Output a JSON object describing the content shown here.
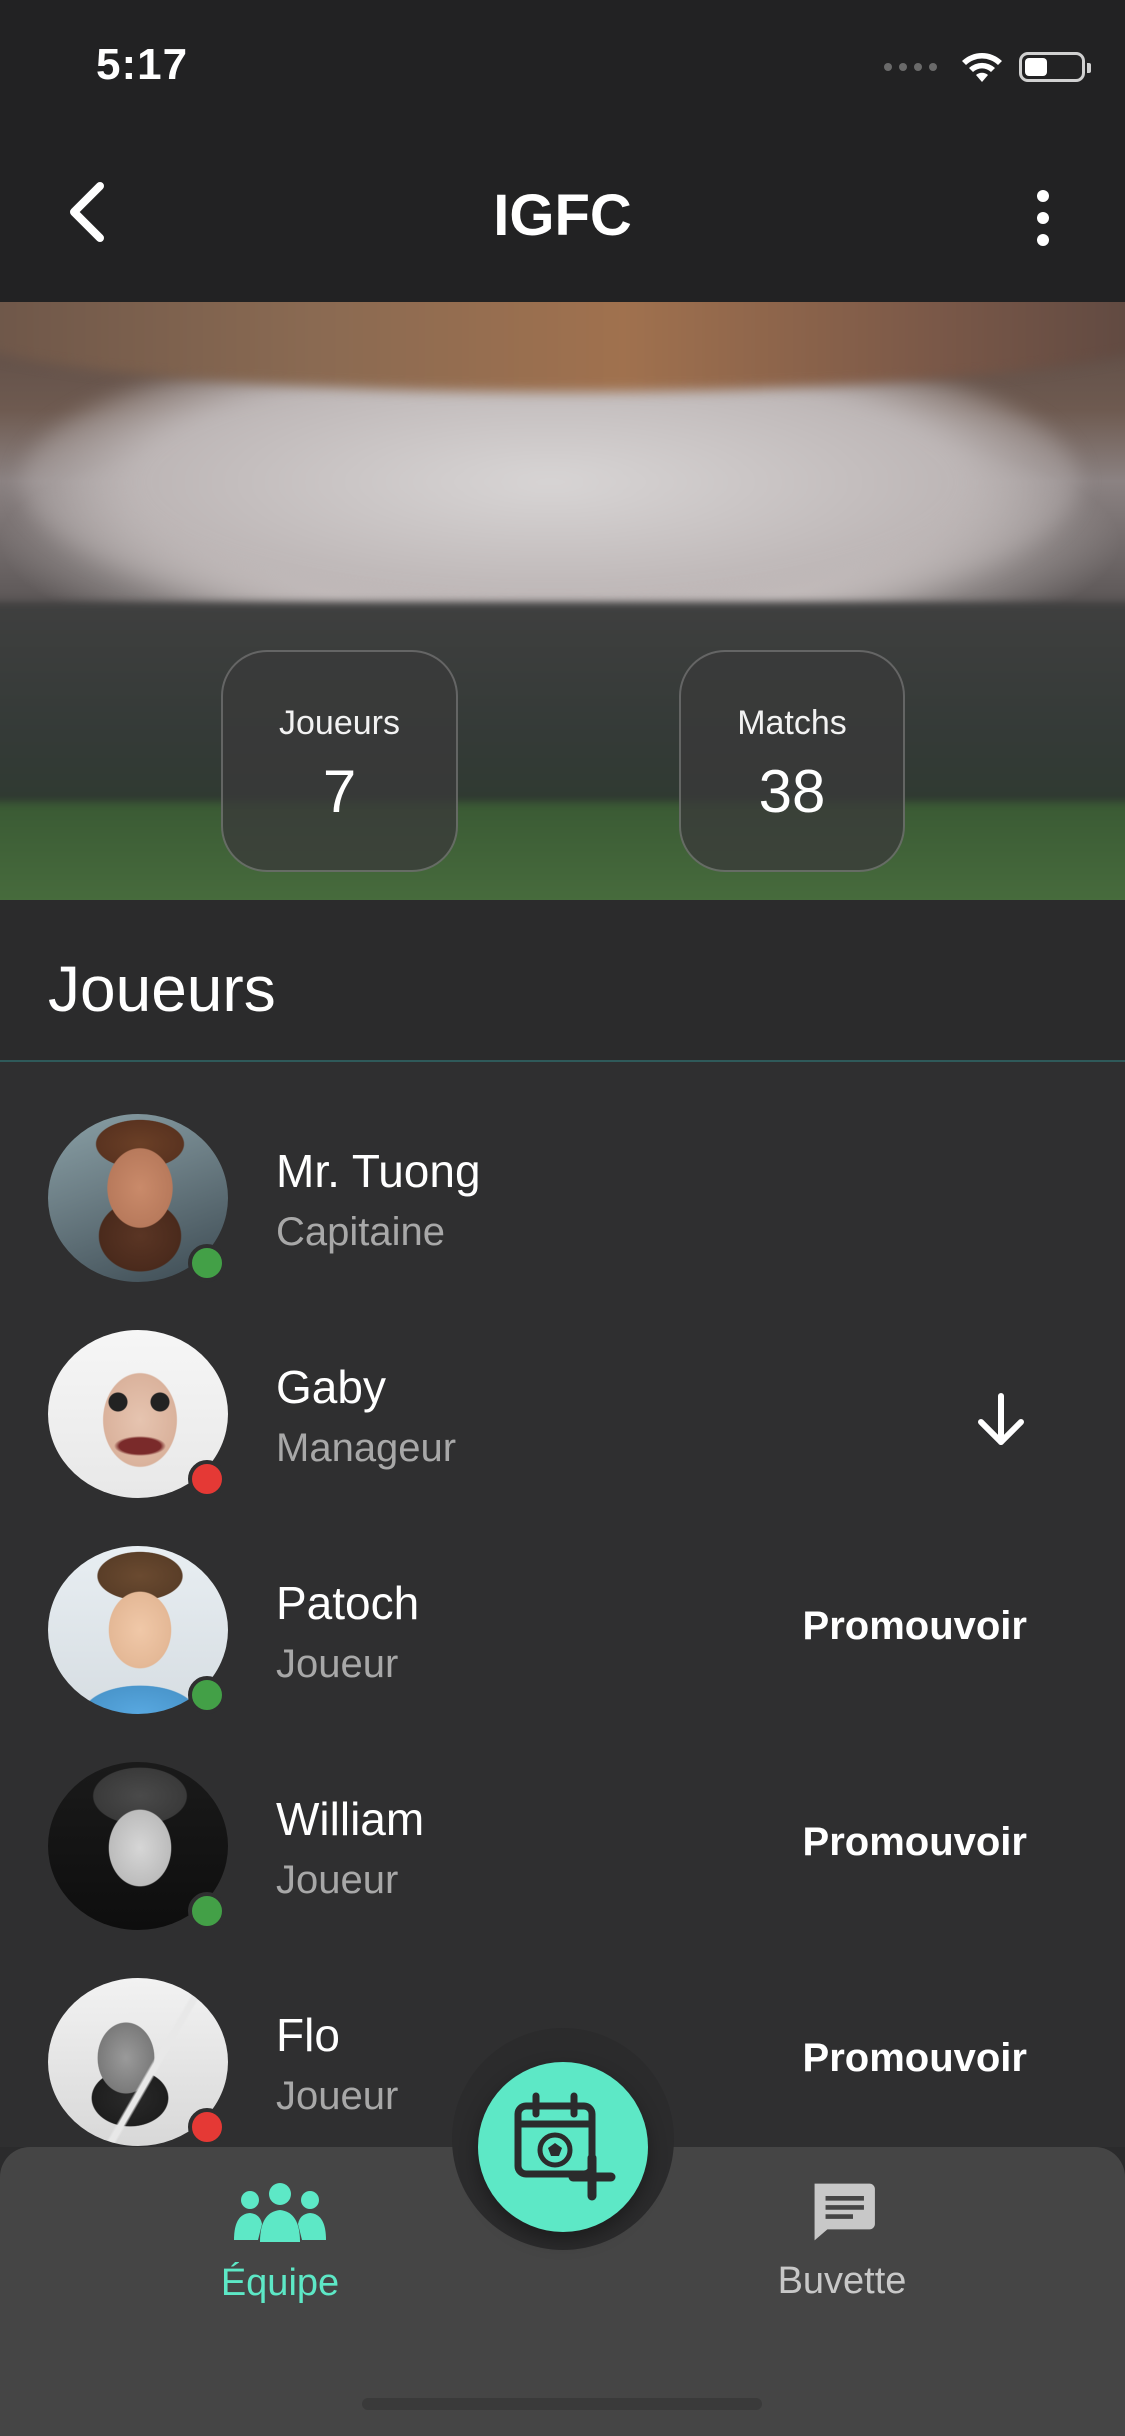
{
  "status_bar": {
    "time": "5:17"
  },
  "nav": {
    "title": "IGFC",
    "back_icon": "chevron-left-icon",
    "more_icon": "more-vertical-icon"
  },
  "hero": {
    "stats": [
      {
        "label": "Joueurs",
        "value": "7"
      },
      {
        "label": "Matchs",
        "value": "38"
      }
    ]
  },
  "section": {
    "title": "Joueurs"
  },
  "players": [
    {
      "name": "Mr. Tuong",
      "role": "Capitaine",
      "status": "online",
      "action": ""
    },
    {
      "name": "Gaby",
      "role": "Manageur",
      "status": "offline",
      "action": "demote"
    },
    {
      "name": "Patoch",
      "role": "Joueur",
      "status": "online",
      "action": "Promouvoir"
    },
    {
      "name": "William",
      "role": "Joueur",
      "status": "online",
      "action": "Promouvoir"
    },
    {
      "name": "Flo",
      "role": "Joueur",
      "status": "offline",
      "action": "Promouvoir"
    }
  ],
  "bottom_bar": {
    "tabs": [
      {
        "label": "Équipe",
        "icon": "team-icon",
        "active": true
      },
      {
        "label": "Buvette",
        "icon": "chat-icon",
        "active": false
      }
    ],
    "fab_icon": "add-match-calendar-icon"
  },
  "colors": {
    "accent": "#5de8c6",
    "online": "#43a047",
    "offline": "#e53935",
    "background": "#2b2b2c"
  }
}
